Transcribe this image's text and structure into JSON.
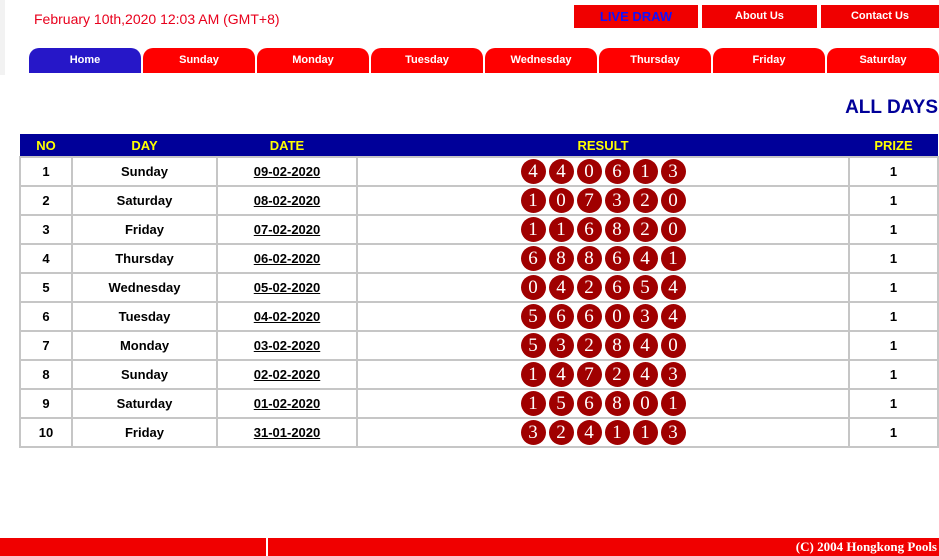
{
  "header": {
    "datetime": "February 10th,2020 12:03 AM (GMT+8)",
    "nav": {
      "live": "LIVE DRAW",
      "about": "About Us",
      "contact": "Contact Us"
    }
  },
  "tabs": [
    "Home",
    "Sunday",
    "Monday",
    "Tuesday",
    "Wednesday",
    "Thursday",
    "Friday",
    "Saturday"
  ],
  "active_tab": "Home",
  "section_title": "ALL DAYS",
  "table": {
    "headers": {
      "no": "NO",
      "day": "DAY",
      "date": "DATE",
      "result": "RESULT",
      "prize": "PRIZE"
    },
    "rows": [
      {
        "no": "1",
        "day": "Sunday",
        "date": "09-02-2020",
        "result": [
          "4",
          "4",
          "0",
          "6",
          "1",
          "3"
        ],
        "prize": "1"
      },
      {
        "no": "2",
        "day": "Saturday",
        "date": "08-02-2020",
        "result": [
          "1",
          "0",
          "7",
          "3",
          "2",
          "0"
        ],
        "prize": "1"
      },
      {
        "no": "3",
        "day": "Friday",
        "date": "07-02-2020",
        "result": [
          "1",
          "1",
          "6",
          "8",
          "2",
          "0"
        ],
        "prize": "1"
      },
      {
        "no": "4",
        "day": "Thursday",
        "date": "06-02-2020",
        "result": [
          "6",
          "8",
          "8",
          "6",
          "4",
          "1"
        ],
        "prize": "1"
      },
      {
        "no": "5",
        "day": "Wednesday",
        "date": "05-02-2020",
        "result": [
          "0",
          "4",
          "2",
          "6",
          "5",
          "4"
        ],
        "prize": "1"
      },
      {
        "no": "6",
        "day": "Tuesday",
        "date": "04-02-2020",
        "result": [
          "5",
          "6",
          "6",
          "0",
          "3",
          "4"
        ],
        "prize": "1"
      },
      {
        "no": "7",
        "day": "Monday",
        "date": "03-02-2020",
        "result": [
          "5",
          "3",
          "2",
          "8",
          "4",
          "0"
        ],
        "prize": "1"
      },
      {
        "no": "8",
        "day": "Sunday",
        "date": "02-02-2020",
        "result": [
          "1",
          "4",
          "7",
          "2",
          "4",
          "3"
        ],
        "prize": "1"
      },
      {
        "no": "9",
        "day": "Saturday",
        "date": "01-02-2020",
        "result": [
          "1",
          "5",
          "6",
          "8",
          "0",
          "1"
        ],
        "prize": "1"
      },
      {
        "no": "10",
        "day": "Friday",
        "date": "31-01-2020",
        "result": [
          "3",
          "2",
          "4",
          "1",
          "1",
          "3"
        ],
        "prize": "1"
      }
    ]
  },
  "footer": {
    "copyright": "(C) 2004 Hongkong Pools"
  },
  "colors": {
    "brand_red": "#f00000",
    "nav_blue": "#000099",
    "active_tab": "#2617c8",
    "ball": "#a00000",
    "header_text": "#ffff00"
  }
}
